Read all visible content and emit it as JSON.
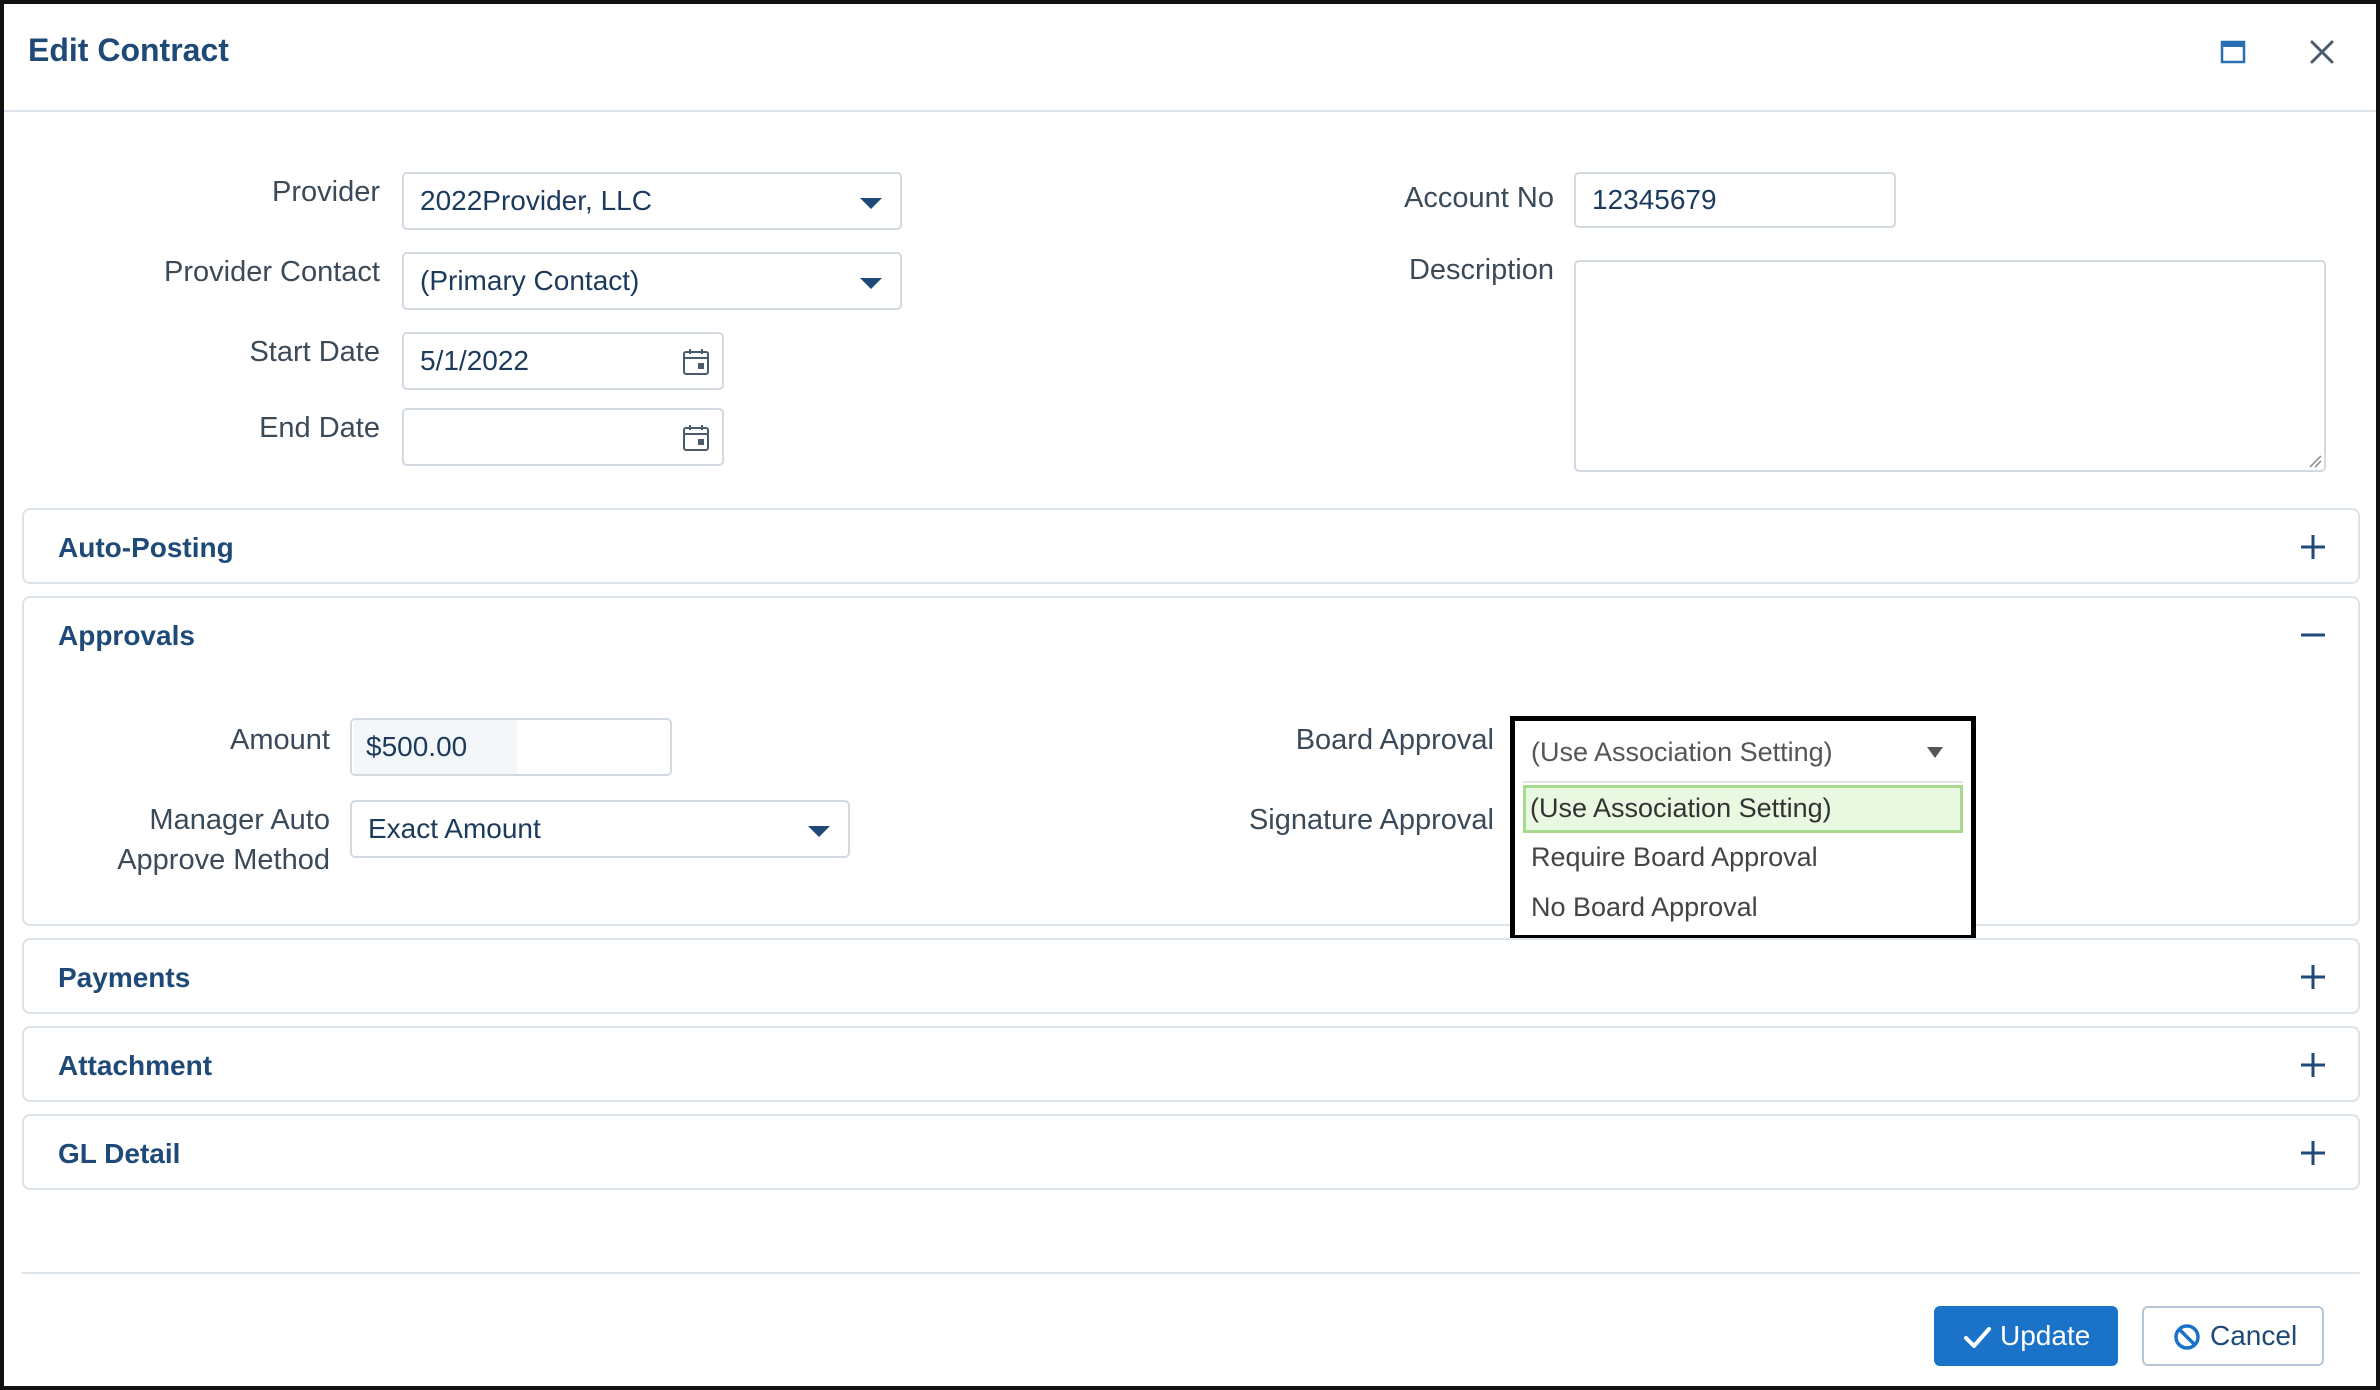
{
  "dialog": {
    "title": "Edit Contract",
    "maximize_icon": "maximize-icon",
    "close_icon": "close-icon"
  },
  "form": {
    "provider": {
      "label": "Provider",
      "value": "2022Provider, LLC"
    },
    "provider_contact": {
      "label": "Provider Contact",
      "value": "(Primary Contact)"
    },
    "start_date": {
      "label": "Start Date",
      "value": "5/1/2022"
    },
    "end_date": {
      "label": "End Date",
      "value": ""
    },
    "account_no": {
      "label": "Account No",
      "value": "12345679"
    },
    "description": {
      "label": "Description",
      "value": ""
    }
  },
  "panels": {
    "auto_posting": {
      "title": "Auto-Posting",
      "expanded": false
    },
    "approvals": {
      "title": "Approvals",
      "expanded": true,
      "amount": {
        "label": "Amount",
        "value": "$500.00"
      },
      "manager_method": {
        "label_line1": "Manager Auto",
        "label_line2": "Approve Method",
        "value": "Exact Amount"
      },
      "board_approval": {
        "label": "Board Approval",
        "value": "(Use Association Setting)",
        "options": [
          "(Use Association Setting)",
          "Require Board Approval",
          "No Board Approval"
        ],
        "selected_index": 0
      },
      "signature_approval": {
        "label": "Signature Approval"
      }
    },
    "payments": {
      "title": "Payments",
      "expanded": false
    },
    "attachment": {
      "title": "Attachment",
      "expanded": false
    },
    "gl_detail": {
      "title": "GL Detail",
      "expanded": false
    }
  },
  "footer": {
    "update_label": "Update",
    "cancel_label": "Cancel"
  },
  "colors": {
    "accent": "#1a73c9",
    "text": "#1f4a78",
    "selected_option_bg": "#e8f8e1",
    "selected_option_border": "#a8d98c"
  }
}
